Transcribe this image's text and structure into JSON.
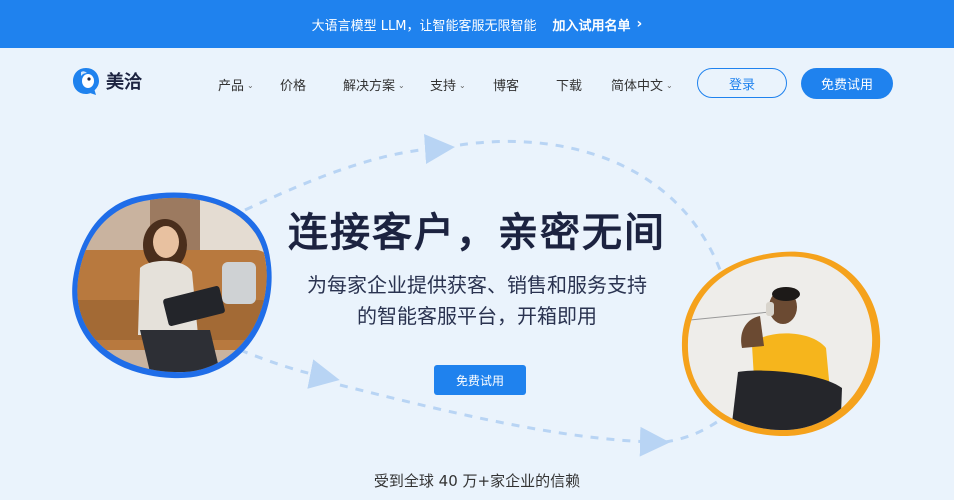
{
  "banner": {
    "text": "大语言模型 LLM，让智能客服无限智能",
    "cta_label": "加入试用名单",
    "cta_icon": "chevron-right-icon"
  },
  "nav": {
    "brand": "美洽",
    "items": [
      {
        "label": "产品",
        "has_dropdown": true
      },
      {
        "label": "价格",
        "has_dropdown": false
      },
      {
        "label": "解决方案",
        "has_dropdown": true
      },
      {
        "label": "支持",
        "has_dropdown": true
      },
      {
        "label": "博客",
        "has_dropdown": false
      },
      {
        "label": "下载",
        "has_dropdown": false
      },
      {
        "label": "简体中文",
        "has_dropdown": true
      }
    ],
    "login_label": "登录",
    "trial_label": "免费试用"
  },
  "hero": {
    "title": "连接客户，亲密无间",
    "subtitle_line1": "为每家企业提供获客、销售和服务支持",
    "subtitle_line2": "的智能客服平台，开箱即用",
    "cta_label": "免费试用",
    "trust_text": "受到全球 40 万+家企业的信赖"
  },
  "colors": {
    "primary": "#1f82ee",
    "background": "#eaf3fc",
    "heading": "#1c2340",
    "accent_orange": "#f5a21c"
  }
}
